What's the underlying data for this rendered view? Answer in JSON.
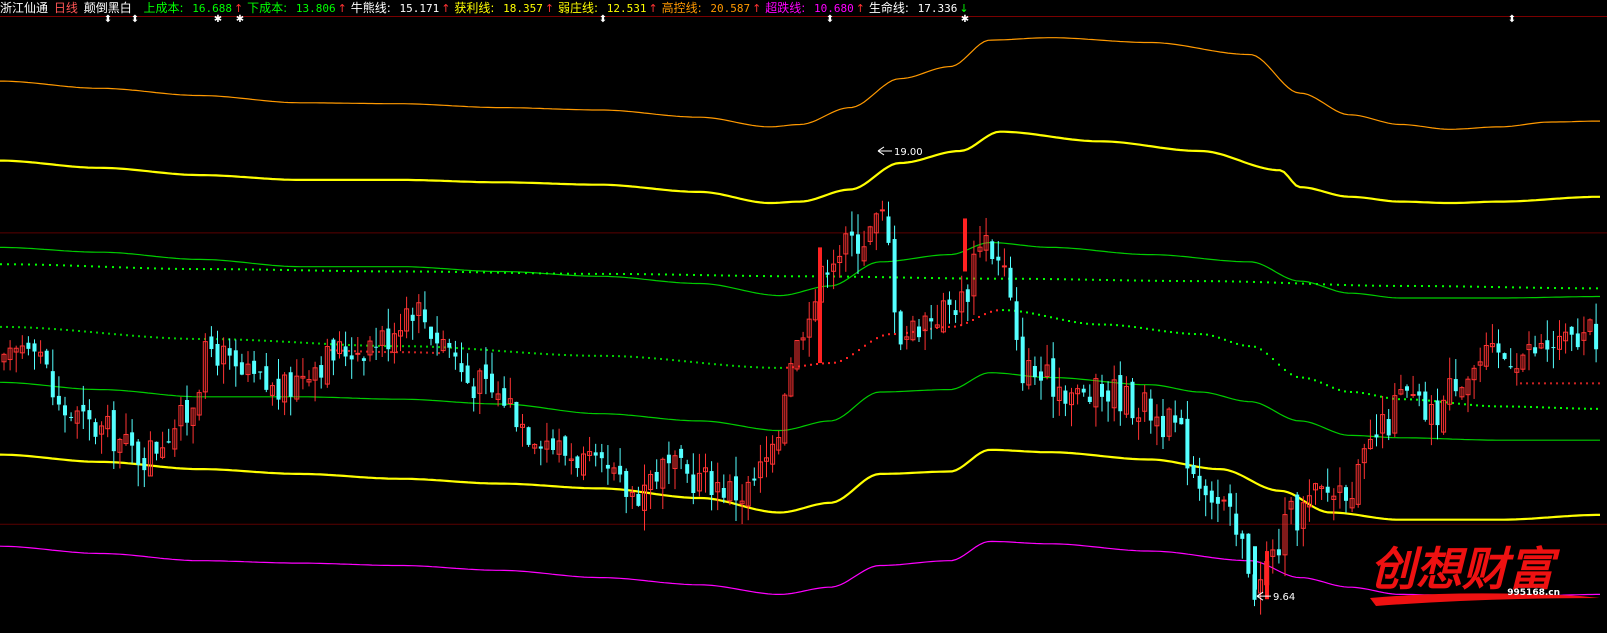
{
  "header": {
    "stock_name": "浙江仙通",
    "period": "日线",
    "formula": "颠倒黑白",
    "indicators": [
      {
        "name": "上成本",
        "value": "16.688",
        "arrow": "↑",
        "color": "#00ff00"
      },
      {
        "name": "下成本",
        "value": "13.806",
        "arrow": "↑",
        "color": "#00ff00"
      },
      {
        "name": "牛熊线",
        "value": "15.171",
        "arrow": "↑",
        "color": "#ffffff"
      },
      {
        "name": "获利线",
        "value": "18.357",
        "arrow": "↑",
        "color": "#ffff00"
      },
      {
        "name": "弱庄线",
        "value": "12.531",
        "arrow": "↑",
        "color": "#ffff00"
      },
      {
        "name": "高控线",
        "value": "20.587",
        "arrow": "↑",
        "color": "#ff9900"
      },
      {
        "name": "超跌线",
        "value": "10.680",
        "arrow": "↑",
        "color": "#ff00ff"
      },
      {
        "name": "生命线",
        "value": "17.336",
        "arrow": "↓",
        "color": "#ffffff"
      }
    ]
  },
  "chart_data": {
    "type": "candlestick",
    "y_range": [
      9.0,
      21.8
    ],
    "annotations": {
      "high_label": "19.00",
      "low_label": "9.64"
    },
    "colors": {
      "up": "#ff3333",
      "down": "#54ffff",
      "high_control": "#ff9900",
      "profit": "#ffff00",
      "upper_cost": "#00cc00",
      "lower_cost": "#00cc00",
      "bull_bear_dots": "#00ff00",
      "life_dots": "#ff2222",
      "oversold": "#ff00ff",
      "weak": "#ffff00"
    },
    "series": {
      "high_control": [
        [
          0,
          20.45
        ],
        [
          100,
          20.3
        ],
        [
          200,
          20.15
        ],
        [
          300,
          20.0
        ],
        [
          400,
          19.98
        ],
        [
          500,
          19.9
        ],
        [
          600,
          19.85
        ],
        [
          700,
          19.7
        ],
        [
          770,
          19.5
        ],
        [
          800,
          19.55
        ],
        [
          850,
          19.9
        ],
        [
          900,
          20.5
        ],
        [
          950,
          20.75
        ],
        [
          990,
          21.3
        ],
        [
          1050,
          21.35
        ],
        [
          1150,
          21.25
        ],
        [
          1250,
          21.0
        ],
        [
          1300,
          20.2
        ],
        [
          1350,
          19.75
        ],
        [
          1400,
          19.55
        ],
        [
          1450,
          19.45
        ],
        [
          1500,
          19.5
        ],
        [
          1550,
          19.6
        ],
        [
          1600,
          19.62
        ]
      ],
      "profit": [
        [
          0,
          18.8
        ],
        [
          100,
          18.65
        ],
        [
          200,
          18.5
        ],
        [
          300,
          18.4
        ],
        [
          400,
          18.4
        ],
        [
          500,
          18.35
        ],
        [
          600,
          18.3
        ],
        [
          700,
          18.15
        ],
        [
          770,
          17.92
        ],
        [
          800,
          17.95
        ],
        [
          850,
          18.2
        ],
        [
          900,
          18.75
        ],
        [
          960,
          19.0
        ],
        [
          1000,
          19.4
        ],
        [
          1100,
          19.2
        ],
        [
          1200,
          19.0
        ],
        [
          1280,
          18.6
        ],
        [
          1300,
          18.25
        ],
        [
          1350,
          18.05
        ],
        [
          1400,
          17.95
        ],
        [
          1450,
          17.92
        ],
        [
          1500,
          17.95
        ],
        [
          1600,
          18.05
        ]
      ],
      "upper_cost": [
        [
          0,
          17.0
        ],
        [
          100,
          16.9
        ],
        [
          200,
          16.75
        ],
        [
          300,
          16.6
        ],
        [
          400,
          16.6
        ],
        [
          500,
          16.5
        ],
        [
          600,
          16.4
        ],
        [
          700,
          16.25
        ],
        [
          780,
          16.0
        ],
        [
          830,
          16.2
        ],
        [
          880,
          16.7
        ],
        [
          950,
          16.85
        ],
        [
          990,
          17.1
        ],
        [
          1050,
          17.0
        ],
        [
          1150,
          16.85
        ],
        [
          1250,
          16.7
        ],
        [
          1300,
          16.3
        ],
        [
          1350,
          16.05
        ],
        [
          1400,
          15.95
        ],
        [
          1500,
          15.95
        ],
        [
          1600,
          15.98
        ]
      ],
      "lower_cost": [
        [
          0,
          14.2
        ],
        [
          100,
          14.05
        ],
        [
          200,
          13.9
        ],
        [
          300,
          13.9
        ],
        [
          400,
          13.85
        ],
        [
          500,
          13.75
        ],
        [
          600,
          13.55
        ],
        [
          700,
          13.4
        ],
        [
          780,
          13.2
        ],
        [
          830,
          13.4
        ],
        [
          880,
          14.0
        ],
        [
          950,
          14.05
        ],
        [
          990,
          14.4
        ],
        [
          1050,
          14.3
        ],
        [
          1150,
          14.15
        ],
        [
          1200,
          14.0
        ],
        [
          1250,
          13.8
        ],
        [
          1300,
          13.4
        ],
        [
          1350,
          13.1
        ],
        [
          1400,
          13.05
        ],
        [
          1500,
          13.0
        ],
        [
          1600,
          13.0
        ]
      ],
      "weak": [
        [
          0,
          12.7
        ],
        [
          100,
          12.55
        ],
        [
          200,
          12.4
        ],
        [
          300,
          12.3
        ],
        [
          400,
          12.2
        ],
        [
          500,
          12.1
        ],
        [
          600,
          12.0
        ],
        [
          700,
          11.8
        ],
        [
          780,
          11.5
        ],
        [
          830,
          11.7
        ],
        [
          880,
          12.3
        ],
        [
          950,
          12.35
        ],
        [
          990,
          12.8
        ],
        [
          1050,
          12.75
        ],
        [
          1150,
          12.6
        ],
        [
          1220,
          12.4
        ],
        [
          1280,
          11.95
        ],
        [
          1330,
          11.5
        ],
        [
          1400,
          11.35
        ],
        [
          1500,
          11.35
        ],
        [
          1600,
          11.45
        ]
      ],
      "oversold": [
        [
          0,
          10.8
        ],
        [
          100,
          10.65
        ],
        [
          200,
          10.5
        ],
        [
          300,
          10.45
        ],
        [
          400,
          10.4
        ],
        [
          500,
          10.3
        ],
        [
          600,
          10.15
        ],
        [
          700,
          10.0
        ],
        [
          780,
          9.8
        ],
        [
          830,
          9.95
        ],
        [
          880,
          10.4
        ],
        [
          950,
          10.5
        ],
        [
          990,
          10.9
        ],
        [
          1050,
          10.85
        ],
        [
          1150,
          10.7
        ],
        [
          1250,
          10.5
        ],
        [
          1300,
          10.15
        ],
        [
          1350,
          9.95
        ],
        [
          1400,
          9.8
        ],
        [
          1500,
          9.75
        ],
        [
          1600,
          9.8
        ]
      ],
      "bull_bear_dots": [
        [
          0,
          16.65
        ],
        [
          200,
          16.55
        ],
        [
          400,
          16.5
        ],
        [
          600,
          16.45
        ],
        [
          800,
          16.4
        ],
        [
          1000,
          16.35
        ],
        [
          1200,
          16.3
        ],
        [
          1400,
          16.2
        ],
        [
          1600,
          16.15
        ]
      ],
      "life_dots": [
        [
          0,
          15.35
        ],
        [
          200,
          15.1
        ],
        [
          400,
          14.95
        ],
        [
          600,
          14.75
        ],
        [
          780,
          14.5
        ],
        [
          830,
          14.6
        ],
        [
          890,
          15.2
        ],
        [
          950,
          15.35
        ],
        [
          1000,
          15.7
        ],
        [
          1100,
          15.4
        ],
        [
          1200,
          15.2
        ],
        [
          1250,
          14.95
        ],
        [
          1300,
          14.3
        ],
        [
          1350,
          14.0
        ],
        [
          1400,
          13.85
        ],
        [
          1500,
          13.7
        ],
        [
          1600,
          13.65
        ]
      ]
    },
    "anchors": [
      [
        0,
        14.5
      ],
      [
        30,
        15.2
      ],
      [
        60,
        13.6
      ],
      [
        100,
        13.2
      ],
      [
        140,
        12.7
      ],
      [
        180,
        13.4
      ],
      [
        210,
        14.9
      ],
      [
        240,
        14.3
      ],
      [
        280,
        14.0
      ],
      [
        310,
        14.6
      ],
      [
        350,
        14.9
      ],
      [
        380,
        15.1
      ],
      [
        410,
        15.8
      ],
      [
        440,
        15.1
      ],
      [
        470,
        14.2
      ],
      [
        500,
        13.9
      ],
      [
        530,
        13.2
      ],
      [
        570,
        12.7
      ],
      [
        600,
        12.3
      ],
      [
        630,
        11.9
      ],
      [
        660,
        12.4
      ],
      [
        700,
        12.2
      ],
      [
        740,
        11.9
      ],
      [
        770,
        12.6
      ],
      [
        790,
        14.8
      ],
      [
        810,
        15.9
      ],
      [
        830,
        16.9
      ],
      [
        860,
        17.2
      ],
      [
        880,
        17.6
      ],
      [
        900,
        15.2
      ],
      [
        930,
        15.6
      ],
      [
        960,
        15.9
      ],
      [
        980,
        17.3
      ],
      [
        1000,
        16.6
      ],
      [
        1020,
        14.5
      ],
      [
        1050,
        14.2
      ],
      [
        1080,
        13.9
      ],
      [
        1110,
        14.0
      ],
      [
        1140,
        13.7
      ],
      [
        1170,
        13.3
      ],
      [
        1200,
        12.2
      ],
      [
        1220,
        11.6
      ],
      [
        1240,
        10.8
      ],
      [
        1255,
        9.9
      ],
      [
        1270,
        10.6
      ],
      [
        1290,
        11.4
      ],
      [
        1320,
        11.9
      ],
      [
        1350,
        12.1
      ],
      [
        1380,
        13.2
      ],
      [
        1400,
        13.9
      ],
      [
        1430,
        13.5
      ],
      [
        1460,
        14.4
      ],
      [
        1490,
        14.7
      ],
      [
        1520,
        14.8
      ],
      [
        1560,
        15.0
      ],
      [
        1600,
        15.2
      ]
    ]
  },
  "logo": {
    "text": "创想财富",
    "site": "995168.cn"
  }
}
